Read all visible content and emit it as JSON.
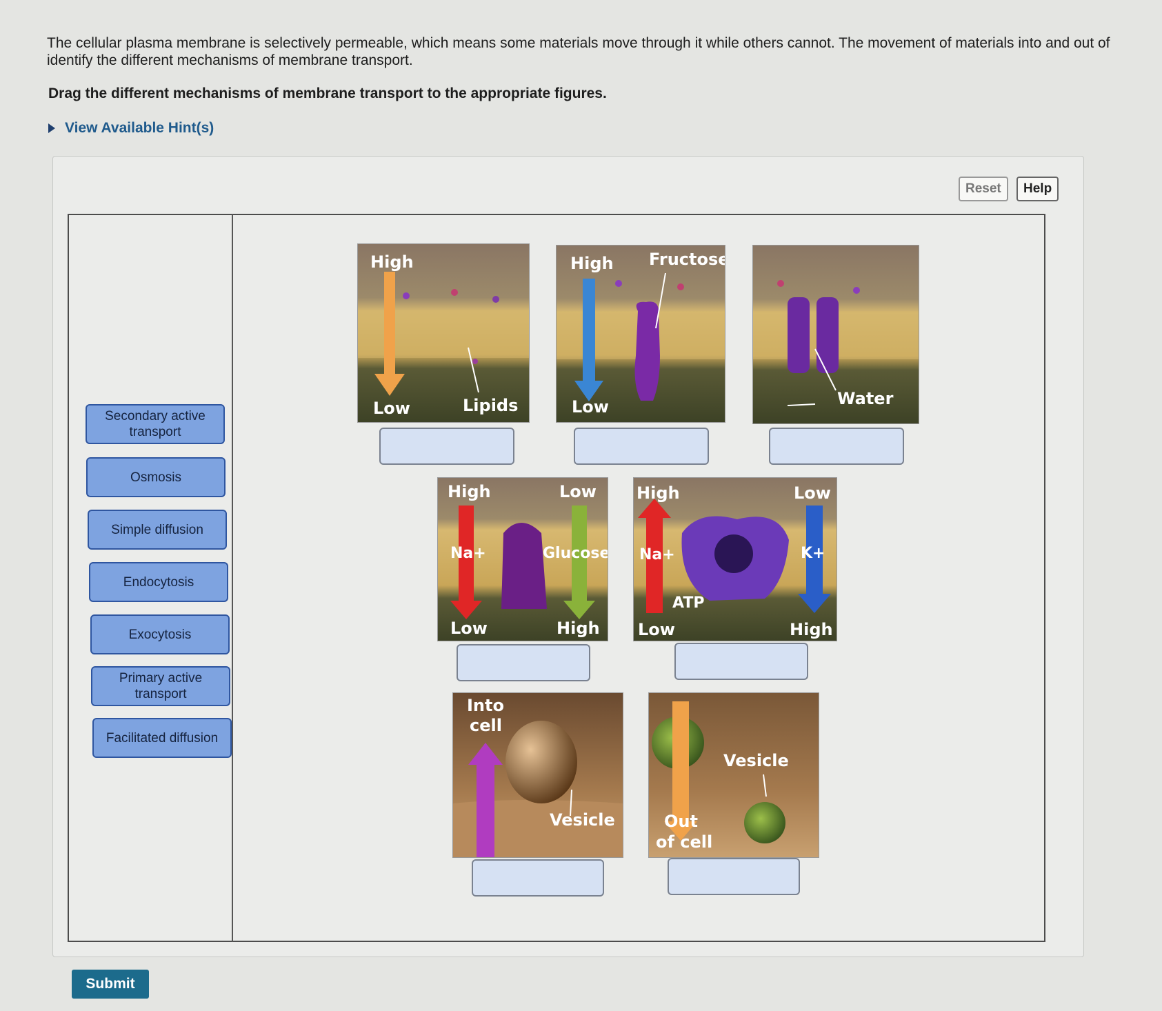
{
  "intro": {
    "line1": "The cellular plasma membrane is selectively permeable, which means some materials move through it while others cannot. The movement of materials into and out of",
    "line2": "identify the different mechanisms of membrane transport."
  },
  "instruction": "Drag the different mechanisms of membrane transport to the appropriate figures.",
  "hint_label": "View Available Hint(s)",
  "buttons": {
    "reset": "Reset",
    "help": "Help",
    "submit": "Submit"
  },
  "labels": [
    "Secondary active transport",
    "Osmosis",
    "Simple diffusion",
    "Endocytosis",
    "Exocytosis",
    "Primary active transport",
    "Facilitated diffusion"
  ],
  "figures": {
    "simple": {
      "top": "High",
      "bottom": "Low",
      "item": "Lipids"
    },
    "facilitated": {
      "top": "High",
      "bottom": "Low",
      "item": "Fructose"
    },
    "osmosis": {
      "item": "Water"
    },
    "secondary": {
      "left_top": "High",
      "left_bottom": "Low",
      "ion": "Na+",
      "right_top": "Low",
      "right_bottom": "High",
      "solute": "Glucose"
    },
    "primary": {
      "left_top": "High",
      "left_bottom": "Low",
      "ion": "Na+",
      "energy": "ATP",
      "right_top": "Low",
      "right_bottom": "High",
      "ion2": "K+"
    },
    "endocytosis": {
      "direction_line1": "Into",
      "direction_line2": "cell",
      "item": "Vesicle"
    },
    "exocytosis": {
      "direction_line1": "Out",
      "direction_line2": "of cell",
      "item": "Vesicle"
    }
  },
  "colors": {
    "tile_bg": "#7ea3e0",
    "tile_border": "#2f56a0",
    "drop_bg": "#d6e1f3",
    "submit_bg": "#1c6b8c",
    "hint": "#1f5a8c",
    "arrow_orange": "#f0a24a",
    "arrow_blue": "#3a86d4",
    "arrow_red": "#e02626",
    "arrow_green": "#8ab23a",
    "arrow_purple": "#b03cc0",
    "arrow_darkblue": "#2a5ec8"
  }
}
